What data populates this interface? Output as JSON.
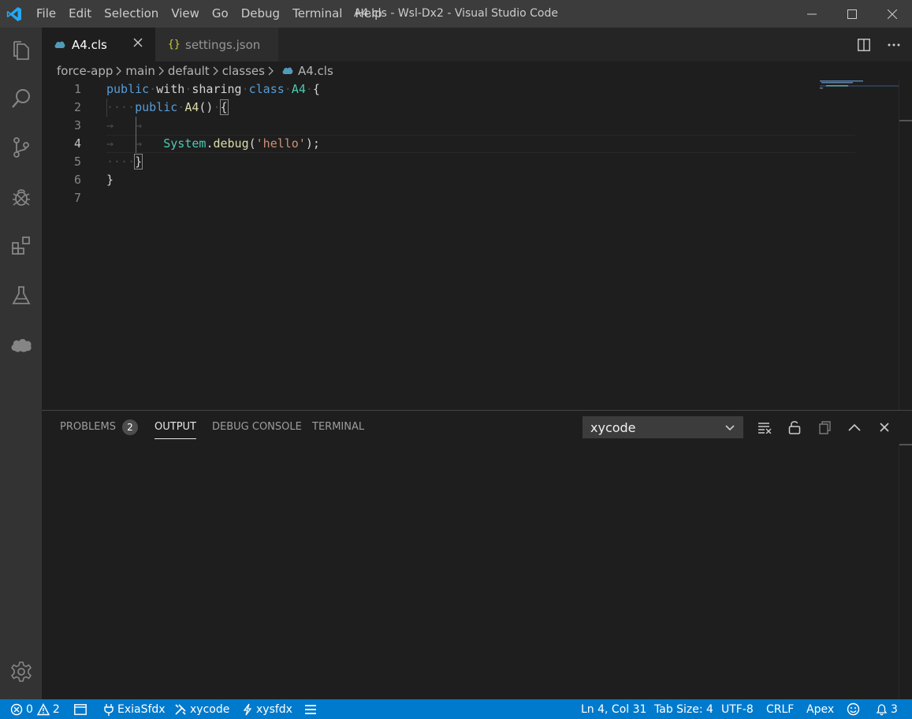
{
  "titlebar": {
    "title": "A4.cls - Wsl-Dx2 - Visual Studio Code",
    "menu": [
      "File",
      "Edit",
      "Selection",
      "View",
      "Go",
      "Debug",
      "Terminal",
      "Help"
    ]
  },
  "tabs": [
    {
      "label": "A4.cls",
      "active": true
    },
    {
      "label": "settings.json",
      "active": false
    }
  ],
  "breadcrumb": [
    "force-app",
    "main",
    "default",
    "classes",
    "A4.cls"
  ],
  "editor": {
    "line_numbers": [
      "1",
      "2",
      "3",
      "4",
      "5",
      "6",
      "7"
    ],
    "code": {
      "l1_kw_public": "public",
      "l1_with": "with",
      "l1_sharing": "sharing",
      "l1_kw_class": "class",
      "l1_name": "A4",
      "l1_brace": "{",
      "l2_kw_public": "public",
      "l2_name": "A4",
      "l2_rest": "()",
      "l2_brace": "{",
      "l4_type": "System",
      "l4_dot": ".",
      "l4_fn": "debug",
      "l4_open": "(",
      "l4_str": "'hello'",
      "l4_close": ");",
      "l5_brace": "}",
      "l6_brace": "}"
    }
  },
  "panel": {
    "tabs": {
      "problems": "PROBLEMS",
      "problems_count": "2",
      "output": "OUTPUT",
      "debug_console": "DEBUG CONSOLE",
      "terminal": "TERMINAL"
    },
    "output_channel": "xycode"
  },
  "statusbar": {
    "errors": "0",
    "warnings": "2",
    "org": "ExiaSfdx",
    "xycode": "xycode",
    "xysfdx": "xysfdx",
    "position": "Ln 4, Col 31",
    "tab_size": "Tab Size: 4",
    "encoding": "UTF-8",
    "eol": "CRLF",
    "language": "Apex",
    "notifications": "3"
  },
  "colors": {
    "accent": "#007acc",
    "keyword": "#569cd6",
    "type": "#4ec9b0",
    "function": "#dcdcaa",
    "string": "#ce9178"
  }
}
